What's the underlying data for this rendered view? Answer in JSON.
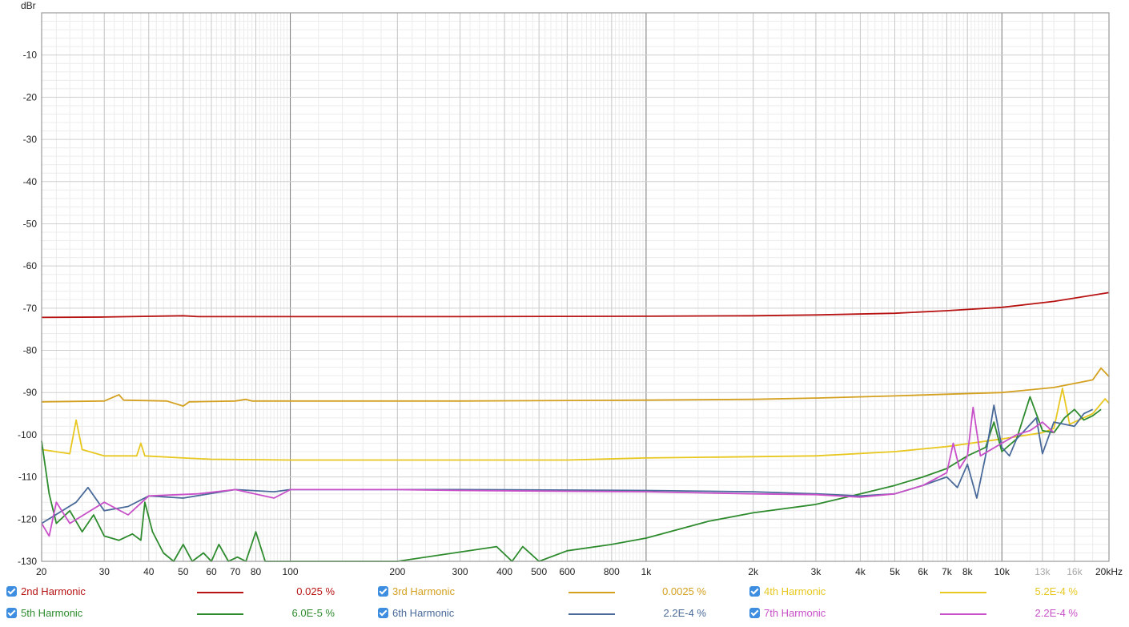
{
  "chart_data": {
    "type": "line",
    "ylabel": "dBr",
    "x_scale": "log",
    "xlim": [
      20,
      20000
    ],
    "ylim": [
      -130,
      0
    ],
    "y_ticks": [
      -10,
      -20,
      -30,
      -40,
      -50,
      -60,
      -70,
      -80,
      -90,
      -100,
      -110,
      -120,
      -130
    ],
    "x_major_ticks": [
      {
        "value": 20,
        "label": "20"
      },
      {
        "value": 30,
        "label": "30"
      },
      {
        "value": 40,
        "label": "40"
      },
      {
        "value": 50,
        "label": "50"
      },
      {
        "value": 60,
        "label": "60"
      },
      {
        "value": 70,
        "label": "70"
      },
      {
        "value": 80,
        "label": "80"
      },
      {
        "value": 100,
        "label": "100"
      },
      {
        "value": 200,
        "label": "200"
      },
      {
        "value": 300,
        "label": "300"
      },
      {
        "value": 400,
        "label": "400"
      },
      {
        "value": 500,
        "label": "500"
      },
      {
        "value": 600,
        "label": "600"
      },
      {
        "value": 800,
        "label": "800"
      },
      {
        "value": 1000,
        "label": "1k"
      },
      {
        "value": 2000,
        "label": "2k"
      },
      {
        "value": 3000,
        "label": "3k"
      },
      {
        "value": 4000,
        "label": "4k"
      },
      {
        "value": 5000,
        "label": "5k"
      },
      {
        "value": 6000,
        "label": "6k"
      },
      {
        "value": 7000,
        "label": "7k"
      },
      {
        "value": 8000,
        "label": "8k"
      },
      {
        "value": 10000,
        "label": "10k"
      }
    ],
    "x_faded_ticks": [
      {
        "value": 13000,
        "label": "13k"
      },
      {
        "value": 16000,
        "label": "16k"
      }
    ],
    "x_end_label": "20kHz",
    "grid": true,
    "legend_position": "bottom",
    "series": [
      {
        "name": "2nd Harmonic",
        "value_label": "0.025 %",
        "color": "#b81414",
        "points": [
          [
            20,
            -72.2
          ],
          [
            30,
            -72.1
          ],
          [
            50,
            -71.8
          ],
          [
            55,
            -72.0
          ],
          [
            100,
            -72
          ],
          [
            300,
            -72
          ],
          [
            1000,
            -71.9
          ],
          [
            2000,
            -71.8
          ],
          [
            3000,
            -71.6
          ],
          [
            5000,
            -71.2
          ],
          [
            7000,
            -70.6
          ],
          [
            10000,
            -69.8
          ],
          [
            14000,
            -68.4
          ],
          [
            20000,
            -66.3
          ]
        ]
      },
      {
        "name": "3rd Harmonic",
        "value_label": "0.0025 %",
        "color": "#d4a020",
        "points": [
          [
            20,
            -92.2
          ],
          [
            30,
            -92.0
          ],
          [
            33,
            -90.5
          ],
          [
            34,
            -91.8
          ],
          [
            45,
            -92.0
          ],
          [
            50,
            -93.2
          ],
          [
            52,
            -92.2
          ],
          [
            70,
            -92.0
          ],
          [
            75,
            -91.6
          ],
          [
            78,
            -92.0
          ],
          [
            100,
            -92
          ],
          [
            300,
            -92
          ],
          [
            1000,
            -91.8
          ],
          [
            2000,
            -91.6
          ],
          [
            3000,
            -91.3
          ],
          [
            5000,
            -90.8
          ],
          [
            7000,
            -90.4
          ],
          [
            10000,
            -90.0
          ],
          [
            14000,
            -88.8
          ],
          [
            18000,
            -87.0
          ],
          [
            19000,
            -84.2
          ],
          [
            20000,
            -86.2
          ]
        ]
      },
      {
        "name": "4th Harmonic",
        "value_label": "5.2E-4 %",
        "color": "#e8c820",
        "points": [
          [
            20,
            -103.5
          ],
          [
            24,
            -104.5
          ],
          [
            25,
            -96.5
          ],
          [
            26,
            -103.5
          ],
          [
            30,
            -105
          ],
          [
            37,
            -105
          ],
          [
            38,
            -102.0
          ],
          [
            39,
            -105
          ],
          [
            50,
            -105.5
          ],
          [
            60,
            -105.8
          ],
          [
            100,
            -106
          ],
          [
            200,
            -106
          ],
          [
            300,
            -106
          ],
          [
            600,
            -106
          ],
          [
            1000,
            -105.5
          ],
          [
            2000,
            -105.2
          ],
          [
            3000,
            -105.0
          ],
          [
            5000,
            -104.0
          ],
          [
            7000,
            -102.8
          ],
          [
            10000,
            -101.0
          ],
          [
            13000,
            -99.5
          ],
          [
            14000,
            -98.5
          ],
          [
            14800,
            -89.0
          ],
          [
            15500,
            -97.5
          ],
          [
            18000,
            -95.0
          ],
          [
            19500,
            -91.5
          ],
          [
            20000,
            -92.5
          ]
        ]
      },
      {
        "name": "5th Harmonic",
        "value_label": "6.0E-5 %",
        "color": "#2e8b2e",
        "points": [
          [
            20,
            -101.5
          ],
          [
            21,
            -114
          ],
          [
            22,
            -121
          ],
          [
            24,
            -118
          ],
          [
            26,
            -123
          ],
          [
            28,
            -119
          ],
          [
            30,
            -124
          ],
          [
            33,
            -125
          ],
          [
            36,
            -123.5
          ],
          [
            38,
            -125
          ],
          [
            39,
            -116
          ],
          [
            41,
            -123
          ],
          [
            44,
            -128
          ],
          [
            47,
            -130
          ],
          [
            50,
            -126
          ],
          [
            53,
            -130
          ],
          [
            57,
            -128
          ],
          [
            60,
            -130
          ],
          [
            63,
            -126
          ],
          [
            67,
            -130
          ],
          [
            71,
            -129
          ],
          [
            75,
            -130
          ],
          [
            80,
            -123
          ],
          [
            85,
            -130
          ],
          [
            100,
            -130
          ],
          [
            200,
            -130
          ],
          [
            380,
            -126.5
          ],
          [
            420,
            -130
          ],
          [
            450,
            -126.5
          ],
          [
            500,
            -130
          ],
          [
            600,
            -127.5
          ],
          [
            800,
            -126
          ],
          [
            1000,
            -124.5
          ],
          [
            1500,
            -120.5
          ],
          [
            2000,
            -118.5
          ],
          [
            3000,
            -116.5
          ],
          [
            4000,
            -114
          ],
          [
            5000,
            -112
          ],
          [
            6000,
            -110
          ],
          [
            7000,
            -108
          ],
          [
            8000,
            -105
          ],
          [
            9000,
            -103
          ],
          [
            9500,
            -97
          ],
          [
            10000,
            -104
          ],
          [
            11000,
            -101
          ],
          [
            12000,
            -91
          ],
          [
            13000,
            -99
          ],
          [
            14000,
            -99.5
          ],
          [
            15000,
            -96
          ],
          [
            16000,
            -94
          ],
          [
            17000,
            -96.5
          ],
          [
            18000,
            -95.5
          ],
          [
            19000,
            -94
          ]
        ]
      },
      {
        "name": "6th Harmonic",
        "value_label": "2.2E-4 %",
        "color": "#4a6a9a",
        "points": [
          [
            20,
            -121
          ],
          [
            25,
            -116
          ],
          [
            27,
            -112.5
          ],
          [
            30,
            -118
          ],
          [
            35,
            -117
          ],
          [
            40,
            -114.5
          ],
          [
            50,
            -115
          ],
          [
            70,
            -113
          ],
          [
            90,
            -113.5
          ],
          [
            100,
            -113
          ],
          [
            200,
            -113
          ],
          [
            300,
            -113
          ],
          [
            1000,
            -113.2
          ],
          [
            2000,
            -113.5
          ],
          [
            3000,
            -114
          ],
          [
            4000,
            -114.5
          ],
          [
            5000,
            -114
          ],
          [
            6000,
            -112
          ],
          [
            7000,
            -110
          ],
          [
            7500,
            -112.5
          ],
          [
            8000,
            -107
          ],
          [
            8500,
            -115
          ],
          [
            9000,
            -105
          ],
          [
            9500,
            -93
          ],
          [
            10000,
            -103
          ],
          [
            10500,
            -105
          ],
          [
            11000,
            -101
          ],
          [
            12500,
            -96
          ],
          [
            13000,
            -104.5
          ],
          [
            14000,
            -97
          ],
          [
            16000,
            -98
          ],
          [
            17000,
            -95
          ],
          [
            18000,
            -94
          ]
        ]
      },
      {
        "name": "7th Harmonic",
        "value_label": "2.2E-4 %",
        "color": "#c850c8",
        "points": [
          [
            20,
            -121
          ],
          [
            21,
            -124
          ],
          [
            22,
            -116
          ],
          [
            24,
            -121
          ],
          [
            30,
            -116
          ],
          [
            35,
            -119
          ],
          [
            40,
            -114.5
          ],
          [
            55,
            -114
          ],
          [
            70,
            -113
          ],
          [
            90,
            -115
          ],
          [
            100,
            -113
          ],
          [
            200,
            -113
          ],
          [
            300,
            -113.2
          ],
          [
            1000,
            -113.5
          ],
          [
            2000,
            -114
          ],
          [
            3000,
            -114.2
          ],
          [
            4000,
            -114.8
          ],
          [
            5000,
            -114
          ],
          [
            6000,
            -112
          ],
          [
            7000,
            -109
          ],
          [
            7300,
            -102
          ],
          [
            7600,
            -108
          ],
          [
            8000,
            -105
          ],
          [
            8300,
            -93.5
          ],
          [
            8700,
            -105
          ],
          [
            10000,
            -102
          ],
          [
            11000,
            -100
          ],
          [
            12000,
            -99
          ],
          [
            13000,
            -97
          ],
          [
            14000,
            -99.5
          ]
        ]
      }
    ]
  }
}
